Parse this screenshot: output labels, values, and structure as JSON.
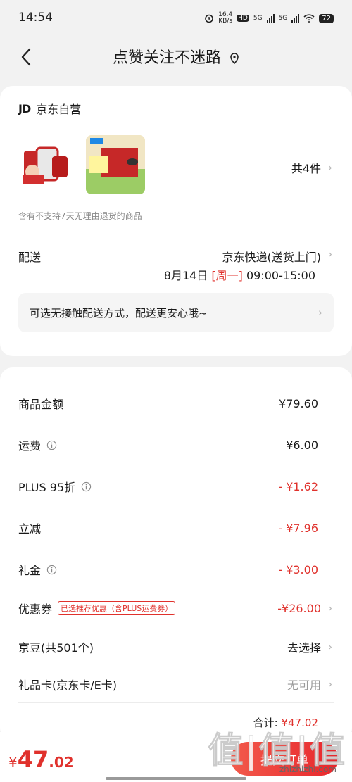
{
  "status_bar": {
    "time": "14:54",
    "network_speed": "16.4",
    "network_unit": "KB/s",
    "hd_badge": "HD",
    "sim1": "5G",
    "sim2": "5G",
    "battery": "72"
  },
  "nav": {
    "title": "点赞关注不迷路"
  },
  "shop": {
    "logo": "JD",
    "name": "京东自营",
    "item_count": "共4件",
    "return_note": "含有不支持7天无理由退货的商品"
  },
  "delivery": {
    "label": "配送",
    "method": "京东快递(送货上门)",
    "date": "8月14日",
    "weekday": "[周一]",
    "time_range": "09:00-15:00",
    "contactless": "可选无接触配送方式，配送更安心哦~"
  },
  "fees": {
    "goods_label": "商品金额",
    "goods_value": "¥79.60",
    "shipping_label": "运费",
    "shipping_value": "¥6.00",
    "plus_label": "PLUS 95折",
    "plus_value": "- ¥1.62",
    "instant_label": "立减",
    "instant_value": "- ¥7.96",
    "gift_label": "礼金",
    "gift_value": "- ¥3.00",
    "coupon_label": "优惠券",
    "coupon_tag": "已选推荐优惠（含PLUS运费券）",
    "coupon_value": "-¥26.00",
    "beans_label": "京豆(共501个)",
    "beans_value": "去选择",
    "giftcard_label": "礼品卡(京东卡/E卡)",
    "giftcard_value": "无可用",
    "total_label": "合计:",
    "total_value": "¥47.02"
  },
  "bottom": {
    "currency": "¥",
    "amount_int": "47",
    "amount_dec": ".02",
    "submit": "提交订单"
  },
  "watermark": {
    "main": "值|值|值",
    "sub": "zhizhizhi.com"
  },
  "colors": {
    "accent": "#e0312c",
    "background": "#f2f2f2"
  }
}
